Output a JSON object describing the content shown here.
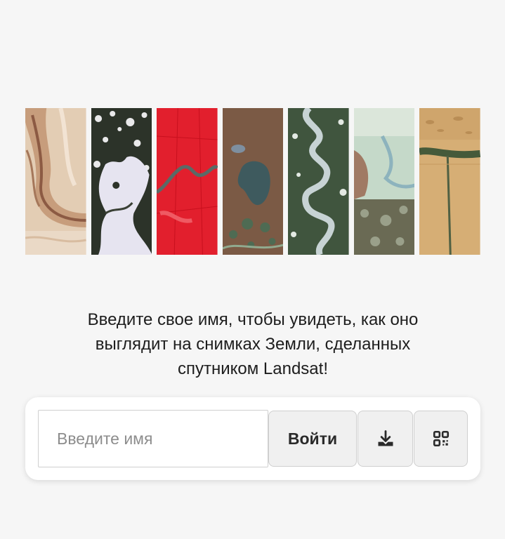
{
  "gallery": {
    "items": [
      {
        "name": "desert-layers",
        "icon": "satellite-image"
      },
      {
        "name": "dark-forest-white-shape",
        "icon": "satellite-image"
      },
      {
        "name": "red-field-river",
        "icon": "satellite-image"
      },
      {
        "name": "brown-land-lake",
        "icon": "satellite-image"
      },
      {
        "name": "green-meander-river",
        "icon": "satellite-image"
      },
      {
        "name": "pale-delta",
        "icon": "satellite-image"
      },
      {
        "name": "sand-dunes-line",
        "icon": "satellite-image"
      }
    ]
  },
  "prompt": {
    "line1": "Введите свое имя, чтобы увидеть, как оно",
    "line2": "выглядит на снимках Земли, сделанных",
    "line3": "спутником Landsat!"
  },
  "form": {
    "name_placeholder": "Введите имя",
    "name_value": "",
    "login_label": "Войти",
    "download_icon": "download-icon",
    "qr_icon": "qr-code-icon"
  }
}
